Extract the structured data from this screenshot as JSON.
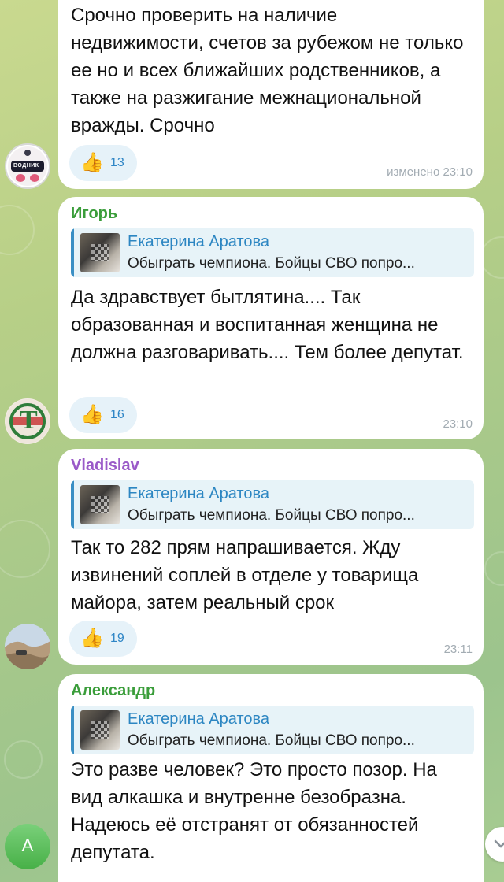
{
  "messages": [
    {
      "sender": "",
      "text": "Срочно проверить на наличие недвижимости, счетов за рубежом не только ее но и всех ближайших родственников, а также на разжигание межнациональной вражды. Срочно",
      "reaction_emoji": "👍",
      "reaction_count": "13",
      "time": "изменено 23:10",
      "avatar_text": "ВОДНИК"
    },
    {
      "sender": "Игорь",
      "sender_color": "#3a9d3a",
      "reply_name": "Екатерина Аратова",
      "reply_text": "Обыграть чемпиона. Бойцы СВО попро...",
      "text": "Да здравствует бытлятина.... Так образованная и воспитанная женщина не должна разговаривать.... Тем более депутат.",
      "reaction_emoji": "👍",
      "reaction_count": "16",
      "time": "23:10",
      "avatar_text": "Т"
    },
    {
      "sender": "Vladislav",
      "sender_color": "#9a5ac8",
      "reply_name": "Екатерина Аратова",
      "reply_text": "Обыграть чемпиона. Бойцы СВО попро...",
      "text": "Так то 282 прям напрашивается. Жду извинений соплей в отделе у товарища майора, затем реальный срок",
      "reaction_emoji": "👍",
      "reaction_count": "19",
      "time": "23:11"
    },
    {
      "sender": "Александр",
      "sender_color": "#3a9d3a",
      "reply_name": "Екатерина Аратова",
      "reply_text": "Обыграть чемпиона. Бойцы СВО попро...",
      "text": "Это разве человек? Это просто позор. На вид алкашка и внутренне безобразна. Надеюсь её отстранят от обязанностей депутата.",
      "avatar_text": "А"
    }
  ],
  "colors": {
    "link_blue": "#2c86c2",
    "reaction_bg": "#e6f2f9",
    "time_gray": "#a3acb3"
  }
}
